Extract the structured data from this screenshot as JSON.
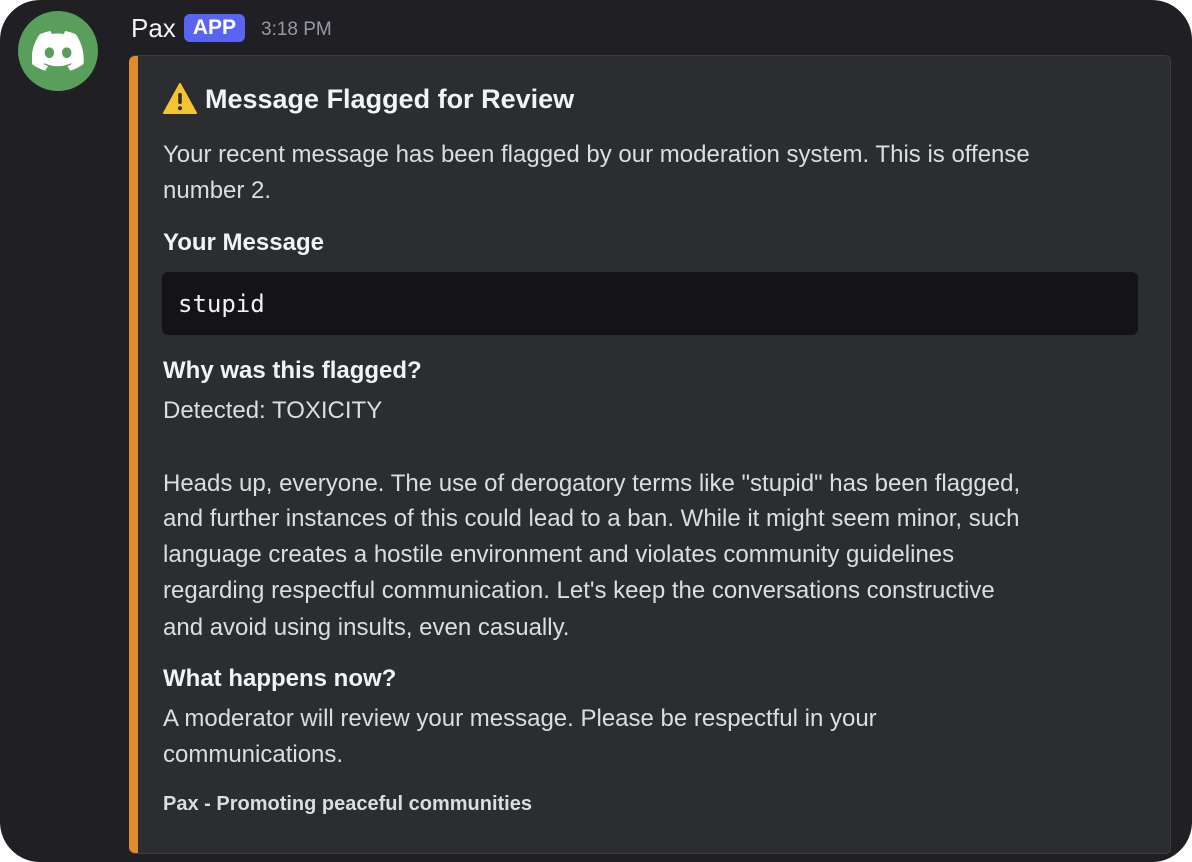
{
  "message": {
    "author": "Pax",
    "badge": "APP",
    "timestamp": "3:18 PM",
    "avatar_icon": "discord-logo-icon",
    "colors": {
      "avatar_bg": "#5a9e5b",
      "badge_bg": "#5865f2",
      "embed_accent": "#e08b32"
    }
  },
  "embed": {
    "icon": "warning-icon",
    "title": "Message Flagged for Review",
    "description": [
      "Your recent message has been flagged by our moderation system. This is offense",
      "number 2."
    ],
    "fields": [
      {
        "name": "Your Message",
        "code": "stupid"
      },
      {
        "name": "Why was this flagged?",
        "lines": [
          "Detected: TOXICITY",
          "",
          "Heads up, everyone. The use of derogatory terms like \"stupid\" has been flagged,",
          "and further instances of this could lead to a ban. While it might seem minor, such",
          "language creates a hostile environment and violates community guidelines",
          "regarding respectful communication. Let's keep the conversations constructive",
          "and avoid using insults, even casually."
        ]
      },
      {
        "name": "What happens now?",
        "lines": [
          "A moderator will review your message. Please be respectful in your",
          "communications."
        ]
      }
    ],
    "footer": "Pax - Promoting peaceful communities"
  }
}
